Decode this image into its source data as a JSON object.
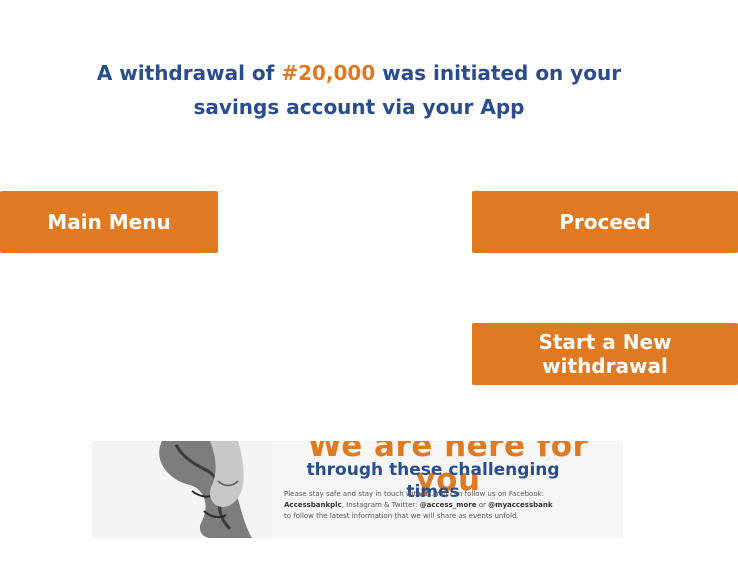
{
  "message": {
    "prefix": "A withdrawal of ",
    "amount": "#20,000",
    "suffix": " was initiated on your savings account via your App"
  },
  "buttons": {
    "main_menu": "Main Menu",
    "proceed": "Proceed",
    "new_withdrawal": "Start a New withdrawal"
  },
  "banner": {
    "headline": "We are here for you",
    "subheadline": "through these challenging times",
    "line1": "Please stay safe and stay in touch with us. You can follow us on Facebook:",
    "line2_bold": "Accessbankplc",
    "line2_rest": ", Instagram & Twitter: ",
    "handle1": "@access_more",
    "or_text": " or ",
    "handle2": "@myaccessbank",
    "line3": "to follow the latest information that we will share as events unfold."
  },
  "colors": {
    "accent": "#e07a22",
    "text_blue": "#2a4d8f",
    "background": "#ffffff"
  }
}
